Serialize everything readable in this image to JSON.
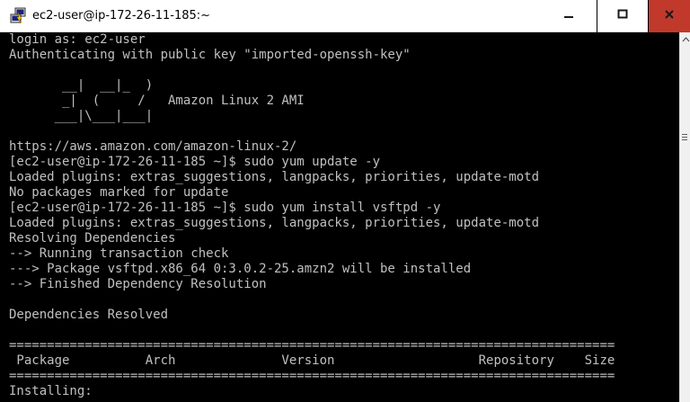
{
  "window": {
    "title": "ec2-user@ip-172-26-11-185:~",
    "icon": "putty-icon",
    "buttons": {
      "minimize_icon": "minimize-icon",
      "maximize_icon": "maximize-icon",
      "close_icon": "close-icon"
    },
    "close_color": "#c0392b"
  },
  "terminal": {
    "foreground": "#c0c0c0",
    "background": "#000000",
    "lines": [
      "login as: ec2-user",
      "Authenticating with public key \"imported-openssh-key\"",
      "",
      "       __|  __|_  )",
      "       _|  (     /   Amazon Linux 2 AMI",
      "      ___|\\___|___|",
      "",
      "https://aws.amazon.com/amazon-linux-2/",
      "[ec2-user@ip-172-26-11-185 ~]$ sudo yum update -y",
      "Loaded plugins: extras_suggestions, langpacks, priorities, update-motd",
      "No packages marked for update",
      "[ec2-user@ip-172-26-11-185 ~]$ sudo yum install vsftpd -y",
      "Loaded plugins: extras_suggestions, langpacks, priorities, update-motd",
      "Resolving Dependencies",
      "--> Running transaction check",
      "---> Package vsftpd.x86_64 0:3.0.2-25.amzn2 will be installed",
      "--> Finished Dependency Resolution",
      "",
      "Dependencies Resolved",
      "",
      "================================================================================",
      " Package          Arch              Version                   Repository    Size",
      "================================================================================",
      "Installing:"
    ]
  }
}
